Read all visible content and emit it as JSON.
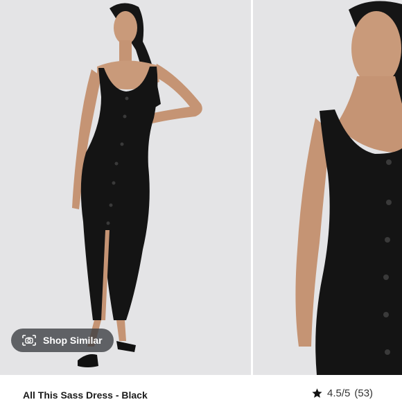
{
  "product": {
    "title": "All This Sass Dress - Black",
    "rating": "4.5/5",
    "review_count": "(53)"
  },
  "actions": {
    "shop_similar_label": "Shop Similar"
  },
  "icons": {
    "camera": "camera-icon",
    "star": "star-icon"
  },
  "colors": {
    "photo_background": "#e4e4e6",
    "dress": "#141414",
    "pill_background": "#3a3c40"
  }
}
